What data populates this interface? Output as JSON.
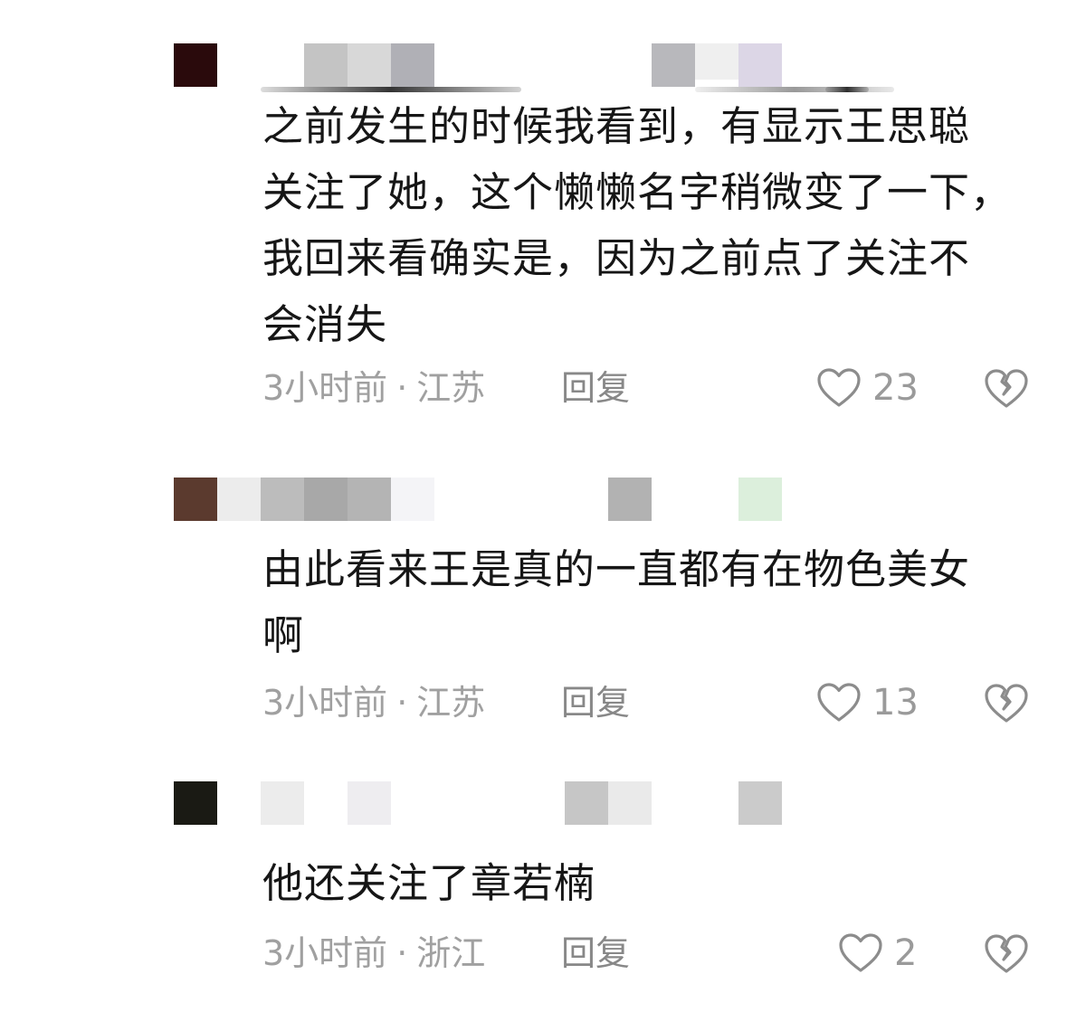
{
  "comments": [
    {
      "text_lines": [
        "之前发生的时候我看到，有显示王思聪",
        "关注了她，这个懒懒名字稍微变了一下，",
        "我回来看确实是，因为之前点了关注不",
        "会消失"
      ],
      "time": "3小时前",
      "separator": "·",
      "location": "江苏",
      "reply_label": "回复",
      "likes": "23",
      "avatar_color": "#2a0a0c"
    },
    {
      "text_lines": [
        "由此看来王是真的一直都有在物色美女",
        "啊"
      ],
      "time": "3小时前",
      "separator": "·",
      "location": "江苏",
      "reply_label": "回复",
      "likes": "13",
      "avatar_color": "#5b3a2e"
    },
    {
      "text_lines": [
        "他还关注了章若楠"
      ],
      "time": "3小时前",
      "separator": "·",
      "location": "浙江",
      "reply_label": "回复",
      "likes": "2",
      "avatar_color": "#1a1a14"
    }
  ],
  "icons": {
    "like": "heart-outline-icon",
    "dislike": "broken-heart-icon"
  }
}
